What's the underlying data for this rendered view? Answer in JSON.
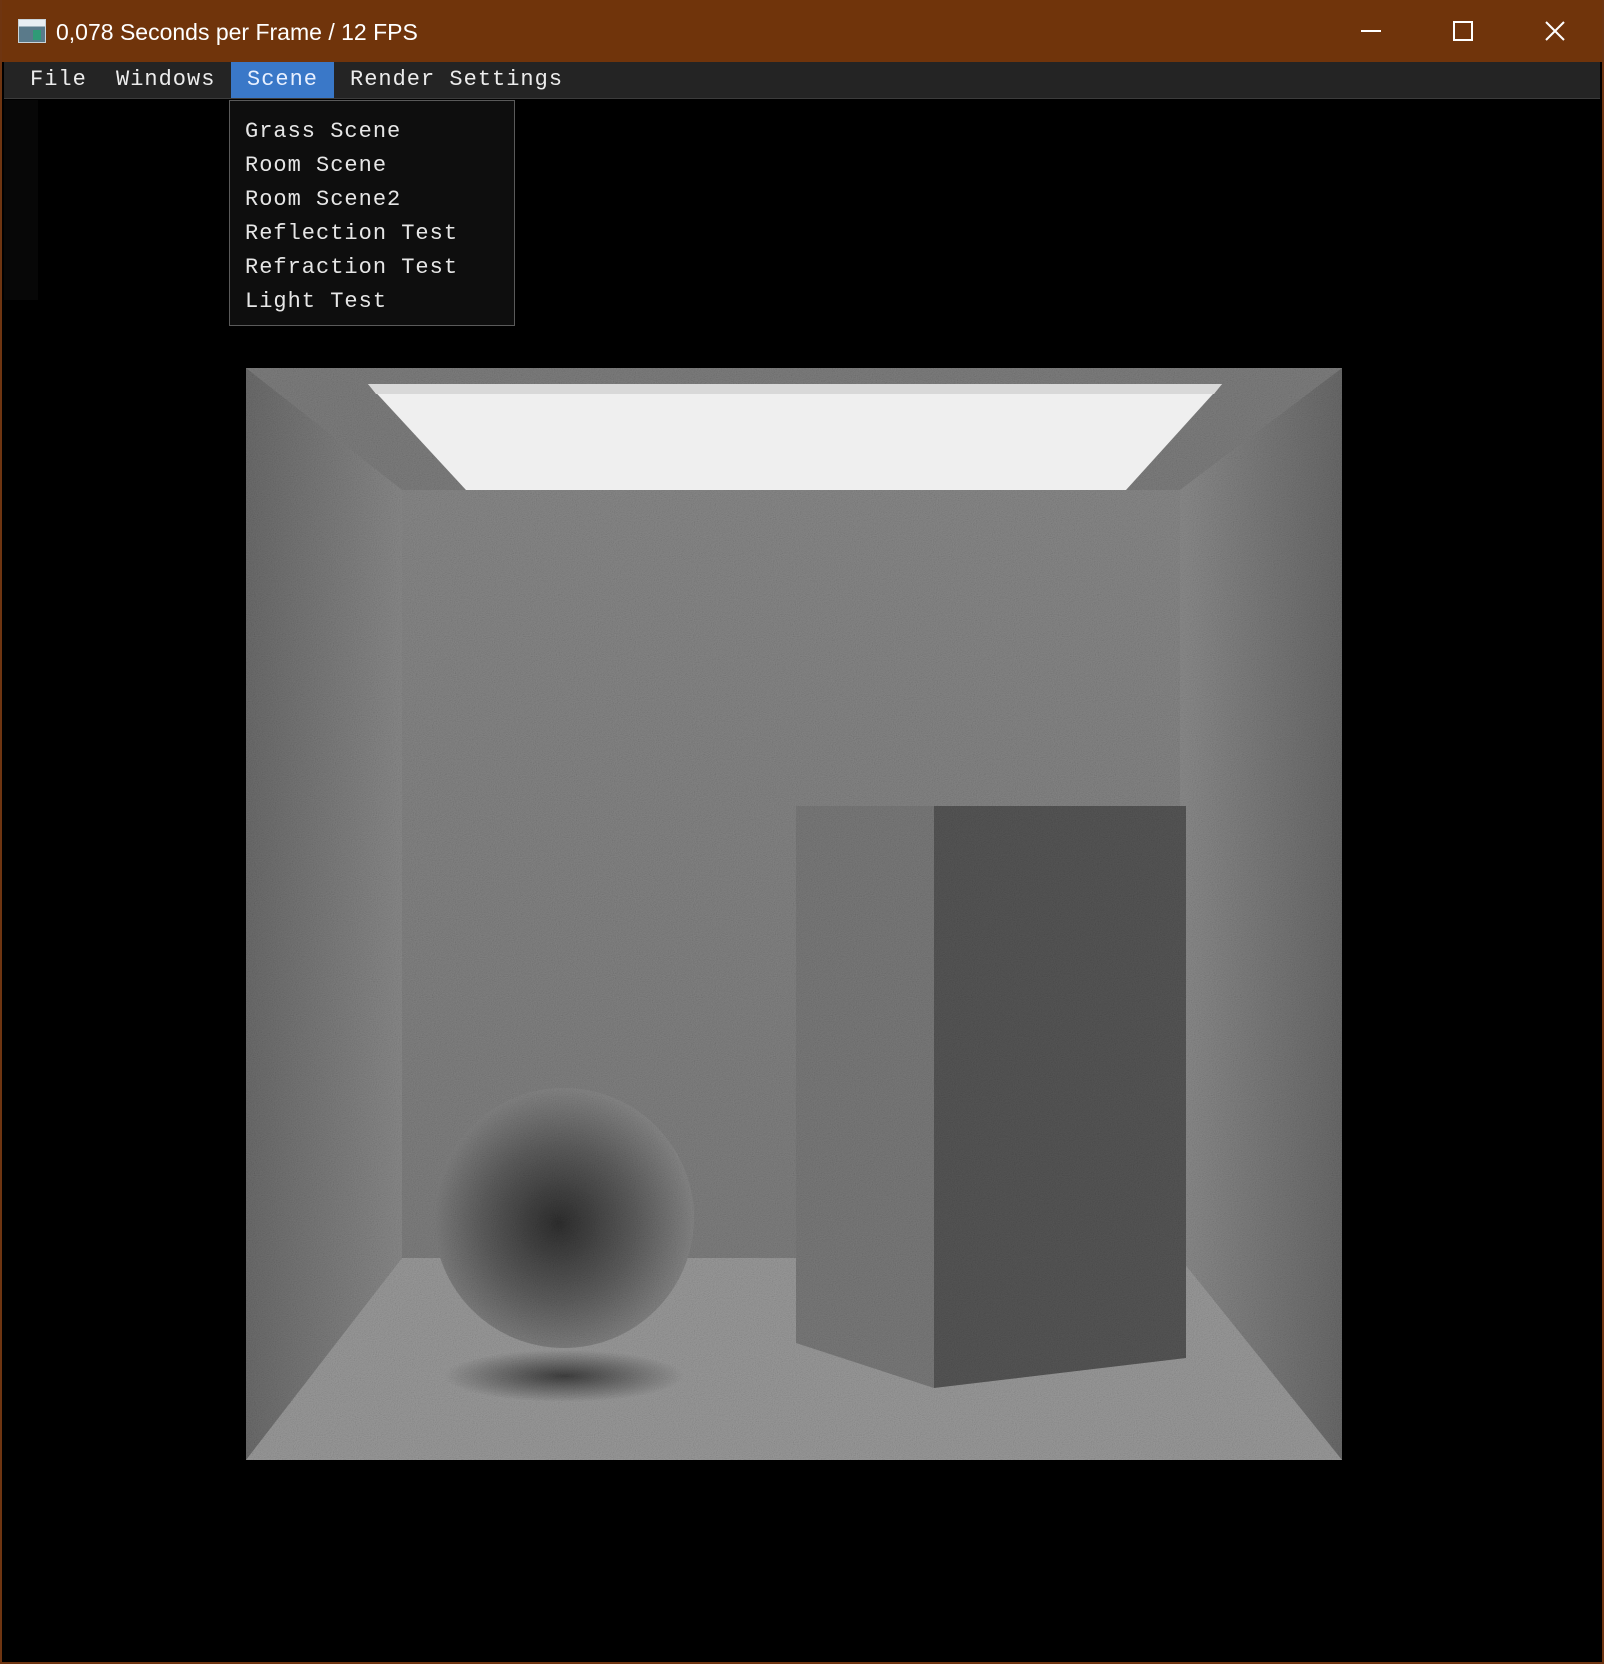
{
  "window": {
    "title": "0,078 Seconds per Frame / 12 FPS",
    "app_icon": "app-icon",
    "title_bar_color": "#70340b",
    "controls": {
      "minimize_icon": "minimize-icon",
      "maximize_icon": "maximize-icon",
      "close_icon": "close-icon"
    }
  },
  "menubar": {
    "items": [
      {
        "label": "File",
        "active": false
      },
      {
        "label": "Windows",
        "active": false
      },
      {
        "label": "Scene",
        "active": true
      },
      {
        "label": "Render Settings",
        "active": false
      }
    ],
    "active_color": "#3a78c8"
  },
  "scene_menu": {
    "items": [
      {
        "label": "Grass Scene"
      },
      {
        "label": "Room Scene"
      },
      {
        "label": "Room Scene2"
      },
      {
        "label": "Reflection Test"
      },
      {
        "label": "Refraction Test"
      },
      {
        "label": "Light Test"
      }
    ]
  },
  "viewport": {
    "content": "path-traced room render with ceiling light, sphere and box"
  }
}
